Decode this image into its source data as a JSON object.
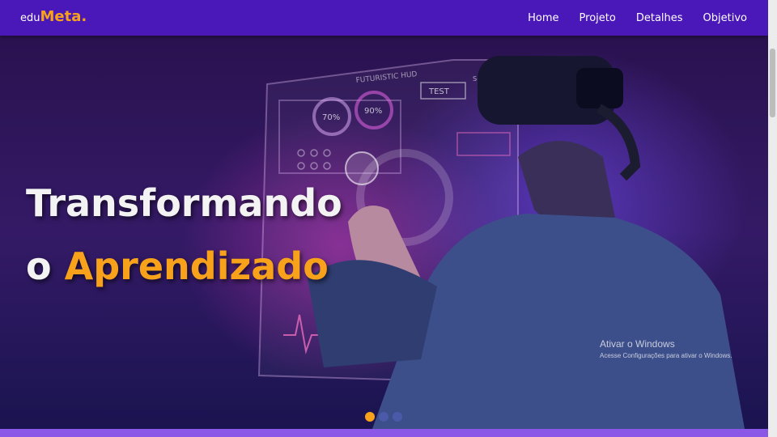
{
  "brand": {
    "logo_light": "edu",
    "logo_bold": "Meta."
  },
  "nav": {
    "items": [
      "Home",
      "Projeto",
      "Detalhes",
      "Objetivo"
    ]
  },
  "hero": {
    "line1": "Transformando",
    "line2_prefix": "o ",
    "line2_accent": "Aprendizado",
    "hud_texts": {
      "label": "FUTURISTIC HUD",
      "test": "TEST",
      "code": "S-01",
      "p1": "70%",
      "p2": "90%"
    },
    "carousel": {
      "slides": 3,
      "active": 1
    }
  },
  "windows_watermark": {
    "title": "Ativar o Windows",
    "subtitle": "Acesse Configurações para ativar o Windows."
  },
  "colors": {
    "navbar": "#4a17b8",
    "accent": "#f7a21a",
    "hero_bg": "#2a1250",
    "strip": "#8a57e6"
  }
}
